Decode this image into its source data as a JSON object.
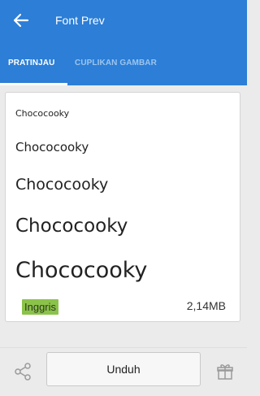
{
  "header": {
    "title": "Font Prev",
    "tabs": [
      {
        "label": "PRATINJAU",
        "active": true
      },
      {
        "label": "CUPLIKAN GAMBAR",
        "active": false
      }
    ]
  },
  "preview": {
    "samples": [
      "Chococooky",
      "Chococooky",
      "Chococooky",
      "Chococooky",
      "Chococooky"
    ],
    "language": "Inggris",
    "file_size": "2,14MB"
  },
  "footer": {
    "download_label": "Unduh"
  },
  "colors": {
    "appbar": "#2c7ed6",
    "badge": "#8bc34a"
  },
  "icons": [
    "back-arrow-icon",
    "share-icon",
    "gift-icon"
  ]
}
